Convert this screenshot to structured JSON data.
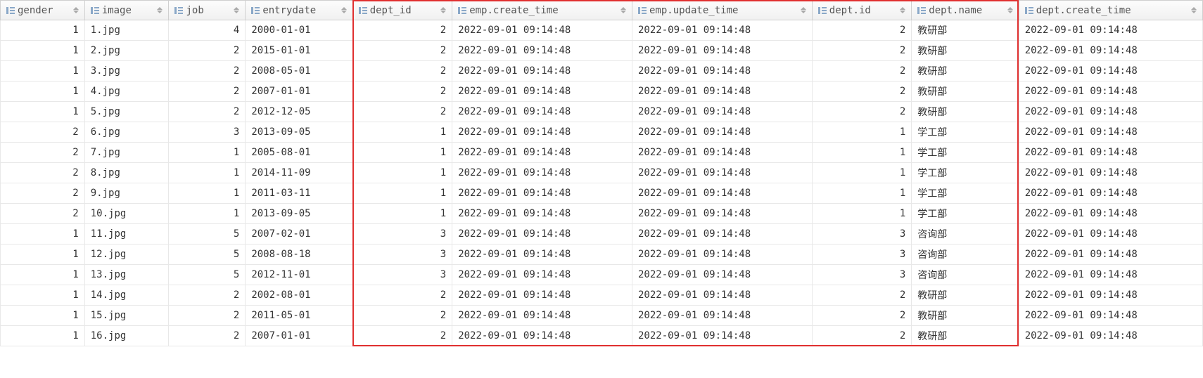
{
  "columns": [
    {
      "key": "gender",
      "label": "gender",
      "align": "num"
    },
    {
      "key": "image",
      "label": "image",
      "align": "text"
    },
    {
      "key": "job",
      "label": "job",
      "align": "num"
    },
    {
      "key": "entrydate",
      "label": "entrydate",
      "align": "text"
    },
    {
      "key": "dept_id",
      "label": "dept_id",
      "align": "num"
    },
    {
      "key": "emp_create_time",
      "label": "emp.create_time",
      "align": "text"
    },
    {
      "key": "emp_update_time",
      "label": "emp.update_time",
      "align": "text"
    },
    {
      "key": "dept_id2",
      "label": "dept.id",
      "align": "num"
    },
    {
      "key": "dept_name",
      "label": "dept.name",
      "align": "text"
    },
    {
      "key": "dept_create_time",
      "label": "dept.create_time",
      "align": "text"
    }
  ],
  "rows": [
    {
      "gender": "1",
      "image": "1.jpg",
      "job": "4",
      "entrydate": "2000-01-01",
      "dept_id": "2",
      "emp_create_time": "2022-09-01 09:14:48",
      "emp_update_time": "2022-09-01 09:14:48",
      "dept_id2": "2",
      "dept_name": "教研部",
      "dept_create_time": "2022-09-01 09:14:48"
    },
    {
      "gender": "1",
      "image": "2.jpg",
      "job": "2",
      "entrydate": "2015-01-01",
      "dept_id": "2",
      "emp_create_time": "2022-09-01 09:14:48",
      "emp_update_time": "2022-09-01 09:14:48",
      "dept_id2": "2",
      "dept_name": "教研部",
      "dept_create_time": "2022-09-01 09:14:48"
    },
    {
      "gender": "1",
      "image": "3.jpg",
      "job": "2",
      "entrydate": "2008-05-01",
      "dept_id": "2",
      "emp_create_time": "2022-09-01 09:14:48",
      "emp_update_time": "2022-09-01 09:14:48",
      "dept_id2": "2",
      "dept_name": "教研部",
      "dept_create_time": "2022-09-01 09:14:48"
    },
    {
      "gender": "1",
      "image": "4.jpg",
      "job": "2",
      "entrydate": "2007-01-01",
      "dept_id": "2",
      "emp_create_time": "2022-09-01 09:14:48",
      "emp_update_time": "2022-09-01 09:14:48",
      "dept_id2": "2",
      "dept_name": "教研部",
      "dept_create_time": "2022-09-01 09:14:48"
    },
    {
      "gender": "1",
      "image": "5.jpg",
      "job": "2",
      "entrydate": "2012-12-05",
      "dept_id": "2",
      "emp_create_time": "2022-09-01 09:14:48",
      "emp_update_time": "2022-09-01 09:14:48",
      "dept_id2": "2",
      "dept_name": "教研部",
      "dept_create_time": "2022-09-01 09:14:48"
    },
    {
      "gender": "2",
      "image": "6.jpg",
      "job": "3",
      "entrydate": "2013-09-05",
      "dept_id": "1",
      "emp_create_time": "2022-09-01 09:14:48",
      "emp_update_time": "2022-09-01 09:14:48",
      "dept_id2": "1",
      "dept_name": "学工部",
      "dept_create_time": "2022-09-01 09:14:48"
    },
    {
      "gender": "2",
      "image": "7.jpg",
      "job": "1",
      "entrydate": "2005-08-01",
      "dept_id": "1",
      "emp_create_time": "2022-09-01 09:14:48",
      "emp_update_time": "2022-09-01 09:14:48",
      "dept_id2": "1",
      "dept_name": "学工部",
      "dept_create_time": "2022-09-01 09:14:48"
    },
    {
      "gender": "2",
      "image": "8.jpg",
      "job": "1",
      "entrydate": "2014-11-09",
      "dept_id": "1",
      "emp_create_time": "2022-09-01 09:14:48",
      "emp_update_time": "2022-09-01 09:14:48",
      "dept_id2": "1",
      "dept_name": "学工部",
      "dept_create_time": "2022-09-01 09:14:48"
    },
    {
      "gender": "2",
      "image": "9.jpg",
      "job": "1",
      "entrydate": "2011-03-11",
      "dept_id": "1",
      "emp_create_time": "2022-09-01 09:14:48",
      "emp_update_time": "2022-09-01 09:14:48",
      "dept_id2": "1",
      "dept_name": "学工部",
      "dept_create_time": "2022-09-01 09:14:48"
    },
    {
      "gender": "2",
      "image": "10.jpg",
      "job": "1",
      "entrydate": "2013-09-05",
      "dept_id": "1",
      "emp_create_time": "2022-09-01 09:14:48",
      "emp_update_time": "2022-09-01 09:14:48",
      "dept_id2": "1",
      "dept_name": "学工部",
      "dept_create_time": "2022-09-01 09:14:48"
    },
    {
      "gender": "1",
      "image": "11.jpg",
      "job": "5",
      "entrydate": "2007-02-01",
      "dept_id": "3",
      "emp_create_time": "2022-09-01 09:14:48",
      "emp_update_time": "2022-09-01 09:14:48",
      "dept_id2": "3",
      "dept_name": "咨询部",
      "dept_create_time": "2022-09-01 09:14:48"
    },
    {
      "gender": "1",
      "image": "12.jpg",
      "job": "5",
      "entrydate": "2008-08-18",
      "dept_id": "3",
      "emp_create_time": "2022-09-01 09:14:48",
      "emp_update_time": "2022-09-01 09:14:48",
      "dept_id2": "3",
      "dept_name": "咨询部",
      "dept_create_time": "2022-09-01 09:14:48"
    },
    {
      "gender": "1",
      "image": "13.jpg",
      "job": "5",
      "entrydate": "2012-11-01",
      "dept_id": "3",
      "emp_create_time": "2022-09-01 09:14:48",
      "emp_update_time": "2022-09-01 09:14:48",
      "dept_id2": "3",
      "dept_name": "咨询部",
      "dept_create_time": "2022-09-01 09:14:48"
    },
    {
      "gender": "1",
      "image": "14.jpg",
      "job": "2",
      "entrydate": "2002-08-01",
      "dept_id": "2",
      "emp_create_time": "2022-09-01 09:14:48",
      "emp_update_time": "2022-09-01 09:14:48",
      "dept_id2": "2",
      "dept_name": "教研部",
      "dept_create_time": "2022-09-01 09:14:48"
    },
    {
      "gender": "1",
      "image": "15.jpg",
      "job": "2",
      "entrydate": "2011-05-01",
      "dept_id": "2",
      "emp_create_time": "2022-09-01 09:14:48",
      "emp_update_time": "2022-09-01 09:14:48",
      "dept_id2": "2",
      "dept_name": "教研部",
      "dept_create_time": "2022-09-01 09:14:48"
    },
    {
      "gender": "1",
      "image": "16.jpg",
      "job": "2",
      "entrydate": "2007-01-01",
      "dept_id": "2",
      "emp_create_time": "2022-09-01 09:14:48",
      "emp_update_time": "2022-09-01 09:14:48",
      "dept_id2": "2",
      "dept_name": "教研部",
      "dept_create_time": "2022-09-01 09:14:48"
    }
  ],
  "highlight": {
    "colStart": 4,
    "colEnd": 8
  }
}
